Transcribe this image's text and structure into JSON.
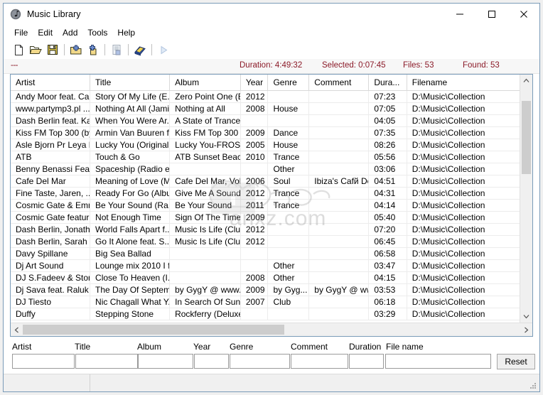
{
  "window": {
    "title": "Music Library",
    "app_icon": "music-note-icon",
    "minimize_label": "minimize-icon",
    "maximize_label": "maximize-icon",
    "close_label": "close-icon"
  },
  "menu": {
    "items": [
      {
        "label": "File"
      },
      {
        "label": "Edit"
      },
      {
        "label": "Add"
      },
      {
        "label": "Tools"
      },
      {
        "label": "Help"
      }
    ]
  },
  "toolbar": {
    "buttons": [
      {
        "icon": "new-file-icon",
        "enabled": true
      },
      {
        "icon": "open-folder-icon",
        "enabled": true
      },
      {
        "icon": "save-disk-icon",
        "enabled": true
      },
      {
        "icon": "add-folder-icon",
        "enabled": true
      },
      {
        "icon": "add-file-icon",
        "enabled": true
      },
      {
        "icon": "export-list-icon",
        "enabled": false
      },
      {
        "icon": "cd-book-icon",
        "enabled": true
      },
      {
        "icon": "play-icon",
        "enabled": false
      }
    ]
  },
  "info": {
    "left": "---",
    "duration": "Duration: 4:49:32",
    "selected": "Selected: 0:07:45",
    "files": "Files: 53",
    "found": "Found: 53",
    "color": "#8b1a28"
  },
  "grid": {
    "columns": [
      {
        "label": "Artist"
      },
      {
        "label": "Title"
      },
      {
        "label": "Album"
      },
      {
        "label": "Year"
      },
      {
        "label": "Genre"
      },
      {
        "label": "Comment"
      },
      {
        "label": "Dura..."
      },
      {
        "label": "Filename"
      }
    ],
    "rows": [
      {
        "artist": "Andy Moor feat. Ca...",
        "title": "Story Of My Life (E...",
        "album": "Zero Point One (Ex...",
        "year": "2012",
        "genre": "",
        "comment": "",
        "duration": "07:23",
        "filename": "D:\\Music\\Collection"
      },
      {
        "artist": "www.partymp3.pl  ...",
        "title": "Nothing At All (Jami...",
        "album": "Nothing at All",
        "year": "2008",
        "genre": "House",
        "comment": "",
        "duration": "07:05",
        "filename": "D:\\Music\\Collection"
      },
      {
        "artist": "Dash Berlin feat. Ka...",
        "title": "When You Were Ar...",
        "album": "A State of Trance E...",
        "year": "",
        "genre": "",
        "comment": "",
        "duration": "04:05",
        "filename": "D:\\Music\\Collection"
      },
      {
        "artist": "Kiss FM Top 300 (by...",
        "title": "Armin Van Buuren f...",
        "album": "Kiss FM Top 300 (b...",
        "year": "2009",
        "genre": "Dance",
        "comment": "",
        "duration": "07:35",
        "filename": "D:\\Music\\Collection"
      },
      {
        "artist": "Asle Bjorn Pr Leya F...",
        "title": "Lucky You (Original ...",
        "album": "Lucky You-FROST0...",
        "year": "2005",
        "genre": "House",
        "comment": "",
        "duration": "08:26",
        "filename": "D:\\Music\\Collection"
      },
      {
        "artist": "ATB",
        "title": "Touch & Go",
        "album": "ATB Sunset Beach ...",
        "year": "2010",
        "genre": "Trance",
        "comment": "",
        "duration": "05:56",
        "filename": "D:\\Music\\Collection"
      },
      {
        "artist": "Benny Benassi Feat ...",
        "title": "Spaceship (Radio e...",
        "album": "",
        "year": "",
        "genre": "Other",
        "comment": "",
        "duration": "03:06",
        "filename": "D:\\Music\\Collection"
      },
      {
        "artist": "Cafe Del Mar",
        "title": "Meaning of Love (M...",
        "album": "Cafe Del Mar, Vol. 13",
        "year": "2006",
        "genre": "Soul",
        "comment": "Ibiza's Cafй Del...",
        "duration": "04:51",
        "filename": "D:\\Music\\Collection"
      },
      {
        "artist": "Fine Taste, Jaren, ...",
        "title": "Ready For Go (Albu...",
        "album": "Give Me A Sound",
        "year": "2012",
        "genre": "Trance",
        "comment": "",
        "duration": "04:31",
        "filename": "D:\\Music\\Collection"
      },
      {
        "artist": "Cosmic Gate & Emm...",
        "title": "Be Your Sound (Ra...",
        "album": "Be Your Sound",
        "year": "2011",
        "genre": "Trance",
        "comment": "",
        "duration": "04:14",
        "filename": "D:\\Music\\Collection"
      },
      {
        "artist": "Cosmic Gate featuri...",
        "title": "Not Enough Time",
        "album": "Sign Of The Times",
        "year": "2009",
        "genre": "",
        "comment": "",
        "duration": "05:40",
        "filename": "D:\\Music\\Collection"
      },
      {
        "artist": "Dash Berlin, Jonath...",
        "title": "World Falls Apart f...",
        "album": "Music Is Life (Club ...",
        "year": "2012",
        "genre": "",
        "comment": "",
        "duration": "07:20",
        "filename": "D:\\Music\\Collection"
      },
      {
        "artist": "Dash Berlin, Sarah H...",
        "title": "Go It Alone feat. S...",
        "album": "Music Is Life (Club ...",
        "year": "2012",
        "genre": "",
        "comment": "",
        "duration": "06:45",
        "filename": "D:\\Music\\Collection"
      },
      {
        "artist": "Davy Spillane",
        "title": "Big Sea Ballad",
        "album": "",
        "year": "",
        "genre": "",
        "comment": "",
        "duration": "06:58",
        "filename": "D:\\Music\\Collection"
      },
      {
        "artist": "Dj Art Sound",
        "title": "Lounge mix 2010 I fly",
        "album": "",
        "year": "",
        "genre": "Other",
        "comment": "",
        "duration": "03:47",
        "filename": "D:\\Music\\Collection"
      },
      {
        "artist": "DJ S.Fadeev & Ston...",
        "title": "Close To Heaven (I...",
        "album": "",
        "year": "2008",
        "genre": "Other",
        "comment": "",
        "duration": "04:15",
        "filename": "D:\\Music\\Collection"
      },
      {
        "artist": "Dj Sava feat. Raluk",
        "title": "The Day Of Septem...",
        "album": "by GygY @ www.M...",
        "year": "2009",
        "genre": "by Gyg...",
        "comment": "by GygY @ ww...",
        "duration": "03:53",
        "filename": "D:\\Music\\Collection"
      },
      {
        "artist": "DJ Tiesto",
        "title": "Nic Chagall  What Y...",
        "album": "In Search Of Sunris...",
        "year": "2007",
        "genre": "Club",
        "comment": "",
        "duration": "06:18",
        "filename": "D:\\Music\\Collection"
      },
      {
        "artist": "Duffy",
        "title": "Stepping Stone",
        "album": "Rockferry (Deluxe ...",
        "year": "",
        "genre": "",
        "comment": "",
        "duration": "03:29",
        "filename": "D:\\Music\\Collection"
      }
    ]
  },
  "filters": {
    "fields": [
      {
        "label": "Artist",
        "value": "",
        "placeholder": ""
      },
      {
        "label": "Title",
        "value": "",
        "placeholder": ""
      },
      {
        "label": "Album",
        "value": "",
        "placeholder": ""
      },
      {
        "label": "Year",
        "value": "",
        "placeholder": ""
      },
      {
        "label": "Genre",
        "value": "",
        "placeholder": ""
      },
      {
        "label": "Comment",
        "value": "",
        "placeholder": ""
      },
      {
        "label": "Duration",
        "value": "",
        "placeholder": ""
      },
      {
        "label": "File name",
        "value": "",
        "placeholder": ""
      }
    ],
    "reset_label": "Reset"
  },
  "statusbar": {
    "pane1": "",
    "pane2": ""
  },
  "watermark": {
    "text": "anxz.com"
  }
}
